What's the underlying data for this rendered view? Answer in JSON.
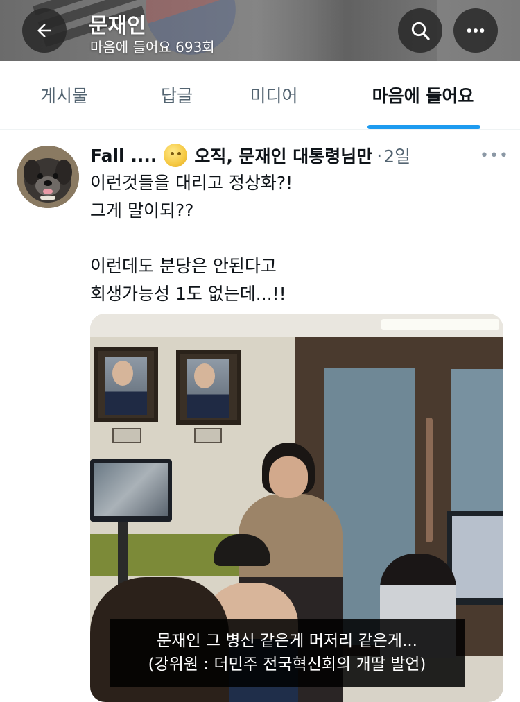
{
  "header": {
    "title": "문재인",
    "subtitle": "마음에 들어요 693회",
    "icons": {
      "back": "back-arrow-icon",
      "search": "search-icon",
      "more": "more-horizontal-icon"
    }
  },
  "tabs": [
    {
      "label": "게시물",
      "active": false
    },
    {
      "label": "답글",
      "active": false
    },
    {
      "label": "미디어",
      "active": false
    },
    {
      "label": "마음에 들어요",
      "active": true
    }
  ],
  "tweet": {
    "author_name": "Fall ....",
    "author_suffix": "오직, 문재인 대통령님만",
    "separator": "·",
    "time": "2일",
    "more": "•••",
    "text": "이런것들을 대리고 정상화?!\n그게 말이되??\n\n이런데도 분당은 안된다고\n회생가능성 1도 없는데...!!",
    "media": {
      "caption_line1": "문재인 그 병신 같은게 머저리 같은게...",
      "caption_line2": "(강위원 : 더민주 전국혁신회의 개딸 발언)"
    }
  },
  "colors": {
    "accent": "#1d9bf0",
    "text": "#0f1419",
    "muted": "#536471"
  }
}
